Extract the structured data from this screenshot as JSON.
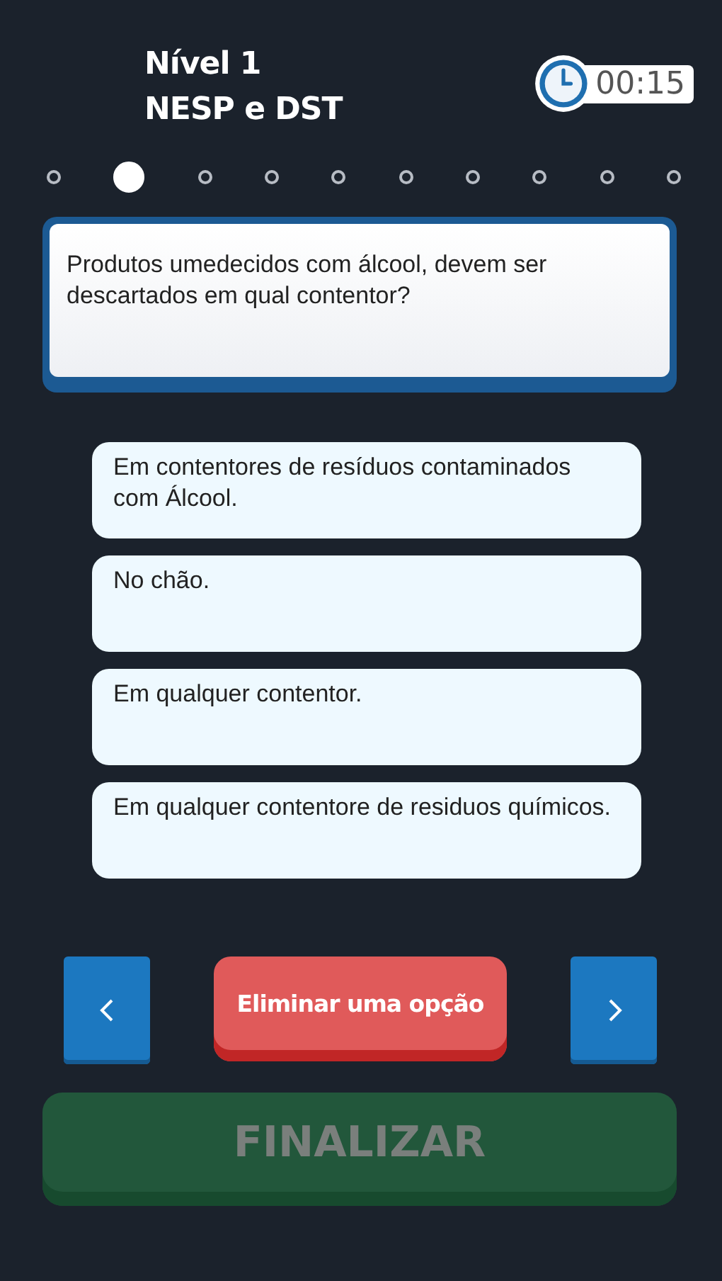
{
  "header": {
    "level": "Nível 1",
    "topic": "NESP e DST"
  },
  "timer": {
    "time": "00:15"
  },
  "progress": [
    {
      "selected": false
    },
    {
      "selected": true
    },
    {
      "selected": false
    },
    {
      "selected": false
    },
    {
      "selected": false
    },
    {
      "selected": false
    },
    {
      "selected": false
    },
    {
      "selected": false
    },
    {
      "selected": false
    },
    {
      "selected": false
    }
  ],
  "question": "Produtos umedecidos com álcool, devem ser descartados em qual contentor?",
  "options": [
    {
      "text": "Em contentores de resíduos contaminados com Álcool."
    },
    {
      "text": "No chão."
    },
    {
      "text": "Em qualquer contentor."
    },
    {
      "text": "Em qualquer contentore de residuos químicos."
    }
  ],
  "eliminate_button": "Eliminar uma opção",
  "finish_button": {
    "label": "FINALIZAR",
    "disabled": true
  }
}
